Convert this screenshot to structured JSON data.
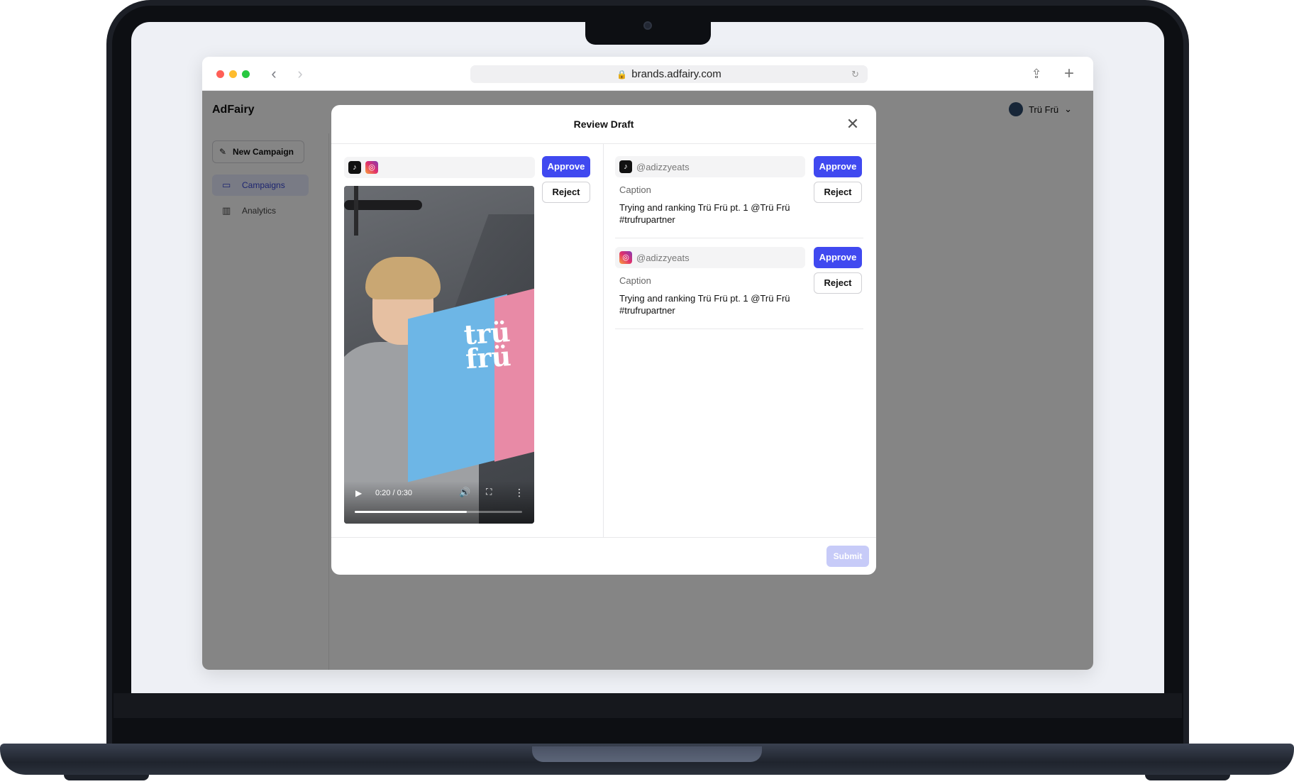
{
  "browser": {
    "url": "brands.adfairy.com"
  },
  "app": {
    "brand": "AdFairy",
    "user": "Trü Frü",
    "sidebar": {
      "new_campaign": "New Campaign",
      "items": [
        {
          "label": "Campaigns",
          "active": true
        },
        {
          "label": "Analytics",
          "active": false
        }
      ]
    }
  },
  "modal": {
    "title": "Review Draft",
    "submit_label": "Submit",
    "approve_label": "Approve",
    "reject_label": "Reject",
    "video": {
      "time": "0:20 / 0:30",
      "progress": 0.67
    },
    "accounts": [
      {
        "platform": "tiktok",
        "handle": "@adizzyeats",
        "caption_label": "Caption",
        "caption": "Trying and ranking Trü Frü pt. 1 @Trü Frü #trufrupartner"
      },
      {
        "platform": "instagram",
        "handle": "@adizzyeats",
        "caption_label": "Caption",
        "caption": "Trying and ranking Trü Frü pt. 1 @Trü Frü #trufrupartner"
      }
    ],
    "box_brand": "trü frü"
  },
  "colors": {
    "accent": "#4049f0",
    "submit_disabled": "#c7cbf8"
  }
}
